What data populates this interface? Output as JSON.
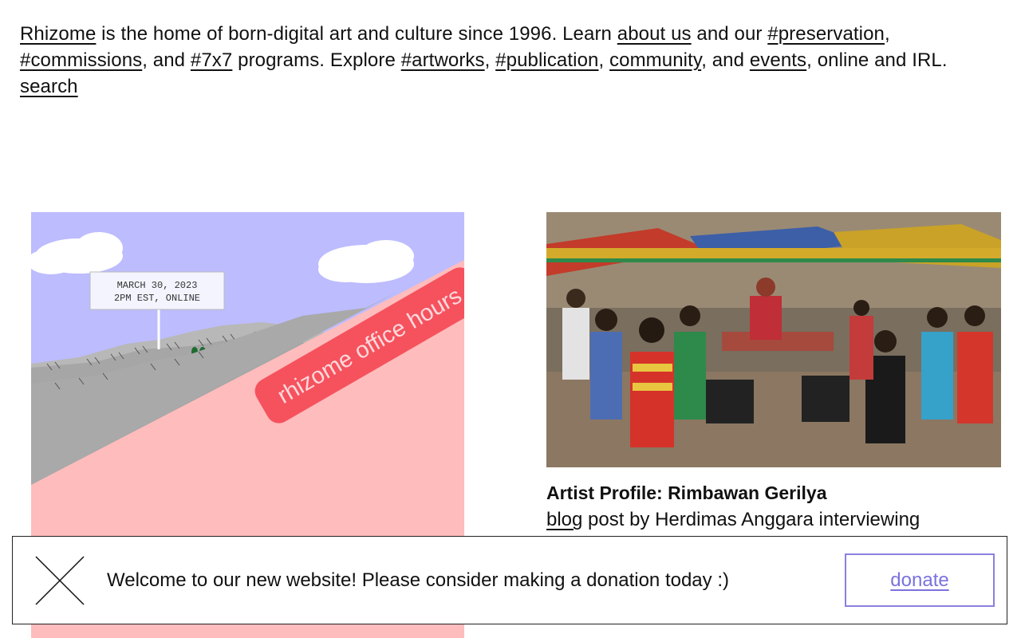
{
  "intro": {
    "rhizome": "Rhizome",
    "t1": " is the home of born-digital art and culture since 1996. Learn ",
    "about_us": "about us",
    "t2": " and our ",
    "preservation": "#preservation",
    "t3": ", ",
    "commissions": "#commissions",
    "t4": ", and ",
    "sevenx7": "#7x7",
    "t5": " programs. Explore ",
    "artworks": "#artworks",
    "t6": ", ",
    "publication": "#publication",
    "t7": ", ",
    "community": "community",
    "t8": ", and ",
    "events": "events",
    "t9": ", online and IRL. ",
    "search": "search"
  },
  "featured_left": {
    "sign_line1": "MARCH 30, 2023",
    "sign_line2": "2PM EST, ONLINE",
    "ribbon": "rhizome office hours",
    "colors": {
      "sky": "#bdbcff",
      "ground": "#ffbcbc",
      "ribbon": "#f5525e",
      "mountain": "#a6a6a6"
    }
  },
  "featured_right": {
    "image_alt": "Artist Profile: Rimbawan Gerilya game scene",
    "title": "Artist Profile: Rimbawan Gerilya",
    "blog_link": "blog",
    "meta_rest": " post by Herdimas Anggara interviewing"
  },
  "banner": {
    "message": "Welcome to our new website! Please consider making a donation today :)",
    "donate": "donate",
    "close_icon": "close-icon",
    "accent": "#7b72dd"
  }
}
